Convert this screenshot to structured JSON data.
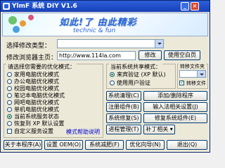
{
  "window": {
    "title": "YlmF 系统 DIY V1.6"
  },
  "banner": {
    "slogan": "如此!了 由此精彩",
    "tagline": "technic & fun"
  },
  "type_select": {
    "label": "选择修改类型：",
    "value": ""
  },
  "homepage": {
    "label": "修改浏览器主页：",
    "value": "http://www.114la.com",
    "modify_button": "修改",
    "blank_button": "使用空白页"
  },
  "optimize": {
    "title": "请选择您需要的优化模式：",
    "options": [
      {
        "label": "家用电脑优化模式",
        "selected": false
      },
      {
        "label": "办公电脑优化模式",
        "selected": false
      },
      {
        "label": "校园电脑优化模式",
        "selected": false
      },
      {
        "label": "笔记本电脑优化模式",
        "selected": false
      },
      {
        "label": "网吧电脑优化模式",
        "selected": false
      },
      {
        "label": "单机电脑优化模式",
        "selected": false
      },
      {
        "label": "当前系统服务状态",
        "selected": true
      },
      {
        "label": "恢复到 XP 默认设置",
        "selected": false
      }
    ],
    "custom_checkbox": "自定义服务设置",
    "help_link": "模式帮助说明"
  },
  "env": {
    "title": "当前系统共享模式：",
    "options": [
      {
        "label": "来宾验证 (XP 默认)",
        "selected": true
      },
      {
        "label": "使用用户验证",
        "selected": false
      }
    ]
  },
  "transfer": {
    "title": "转移文件夹",
    "checkbox": "转移文件"
  },
  "actions": [
    "系统清理(C)",
    "添加/删除程序",
    "注册组件(B)",
    "输入法相关设置(J)",
    "系统修复(S)",
    "修复系统组件(E)",
    "进程管理(T)",
    "补丁相关"
  ],
  "bottom": [
    "关于本程序(A)",
    "设置 OEM(O)",
    "系统减肥(F)",
    "优化向导(N)",
    "退出(Q)"
  ]
}
